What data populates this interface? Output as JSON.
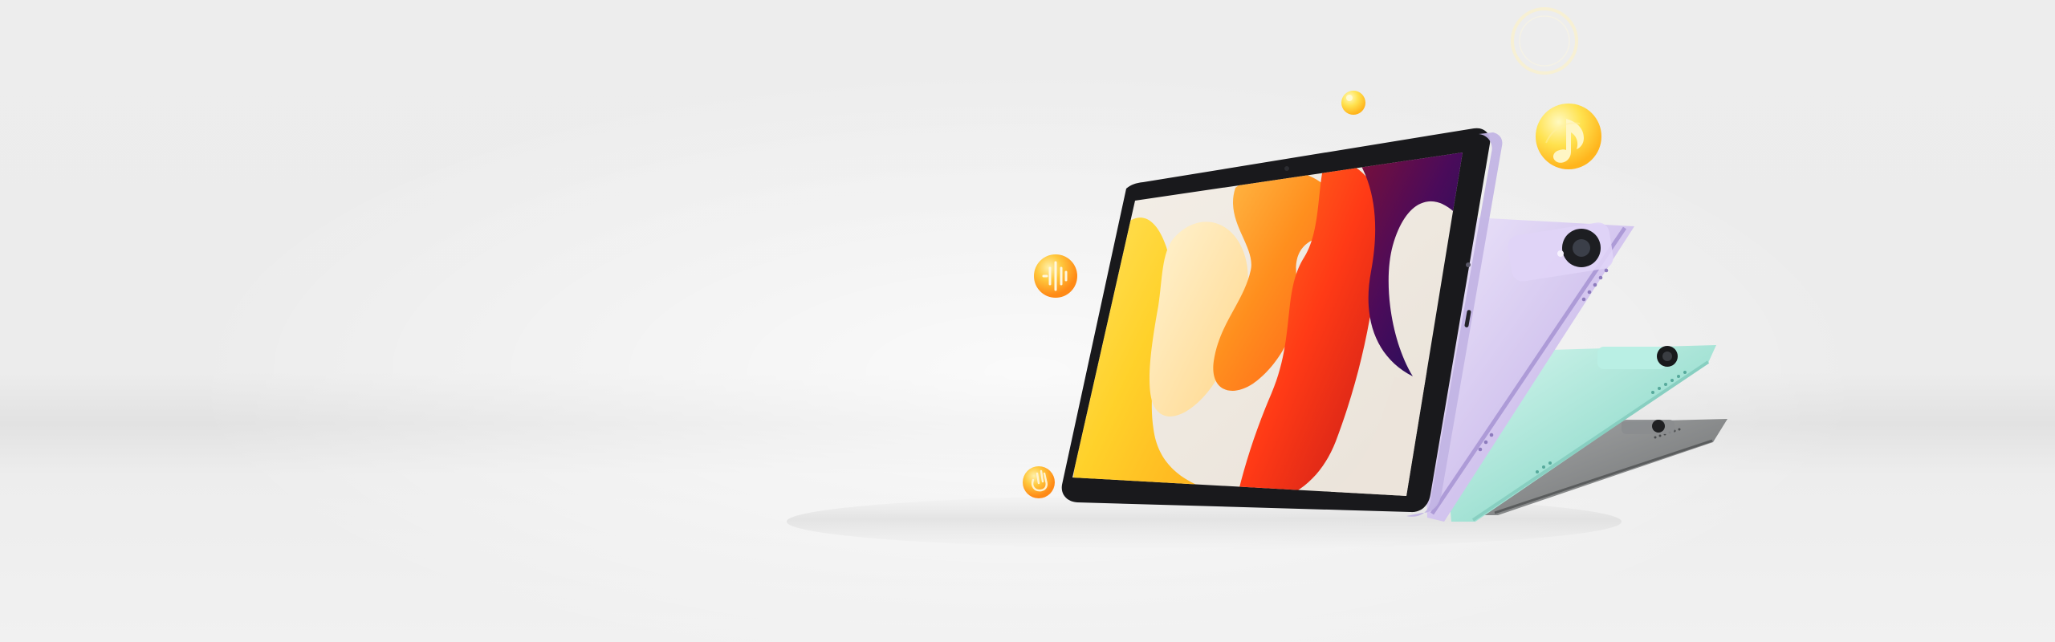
{
  "scene": {
    "background_color": "#ececec",
    "tablet_colors": {
      "front": "#1b1b1f",
      "purple": "#cbbbe7",
      "mint": "#9ee0d2",
      "gray": "#737576"
    },
    "icons": [
      "sound-wave-icon",
      "music-note-icon",
      "hand-icon",
      "sparkle-icon",
      "ring-icon"
    ]
  }
}
